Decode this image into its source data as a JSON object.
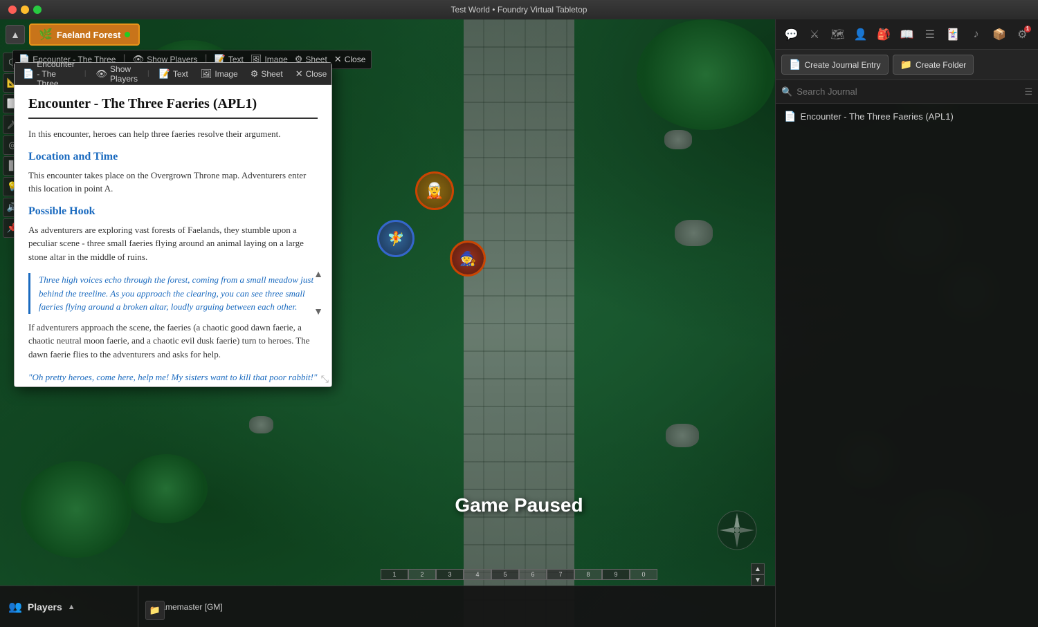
{
  "titlebar": {
    "title": "Test World • Foundry Virtual Tabletop"
  },
  "toolbar": {
    "scene_name": "Faeland Forest",
    "nav_up_icon": "▲"
  },
  "encounter_bar": {
    "encounter_name": "Encounter - The Three",
    "show_players": "Show Players",
    "text_label": "Text",
    "image_label": "Image",
    "sheet_label": "Sheet",
    "close_label": "Close"
  },
  "right_panel": {
    "icons": [
      {
        "name": "chat-icon",
        "symbol": "💬",
        "active": false
      },
      {
        "name": "combat-icon",
        "symbol": "⚔",
        "active": false
      },
      {
        "name": "scenes-icon",
        "symbol": "🗺",
        "active": false
      },
      {
        "name": "actors-icon",
        "symbol": "👤",
        "active": false
      },
      {
        "name": "items-icon",
        "symbol": "🎒",
        "active": false
      },
      {
        "name": "journal-icon",
        "symbol": "📖",
        "active": true
      },
      {
        "name": "tables-icon",
        "symbol": "☰",
        "active": false
      },
      {
        "name": "cards-icon",
        "symbol": "🃏",
        "active": false
      },
      {
        "name": "audio-icon",
        "symbol": "♪",
        "active": false
      },
      {
        "name": "compendium-icon",
        "symbol": "📦",
        "active": false
      },
      {
        "name": "settings-icon",
        "symbol": "⚙",
        "active": false,
        "badge": "1"
      }
    ],
    "create_journal_entry": "Create Journal Entry",
    "create_folder": "Create Folder",
    "search_placeholder": "Search Journal",
    "journal_items": [
      {
        "label": "Encounter - The Three Faeries (APL1)",
        "icon": "📄"
      }
    ]
  },
  "journal_popup": {
    "toolbar": [
      {
        "label": "Encounter Three",
        "icon": "📄"
      },
      {
        "label": "Show Players",
        "icon": "👁"
      },
      {
        "label": "Text",
        "icon": "📝"
      },
      {
        "label": "Image",
        "icon": "🖼"
      },
      {
        "label": "Sheet",
        "icon": "⚙"
      },
      {
        "label": "Close",
        "icon": "✕"
      }
    ],
    "title": "Encounter - The Three Faeries (APL1)",
    "intro": "In this encounter, heroes can help three faeries resolve their argument.",
    "section1_title": "Location and Time",
    "section1_body": "This encounter takes place on the Overgrown Throne map. Adventurers enter this location in point A.",
    "section2_title": "Possible Hook",
    "section2_body": "As adventurers are exploring vast forests of Faelands, they stumble upon a peculiar scene - three small faeries flying around an animal laying on a large stone altar in the middle of ruins.",
    "blockquote": "Three high voices echo through the forest, coming from a small meadow just behind the treeline. As you approach the clearing, you can see three small faeries flying around a broken altar, loudly arguing between each other.",
    "section3_body": "If adventurers approach the scene, the faeries (a chaotic good dawn faerie, a chaotic neutral moon faerie, and a chaotic evil dusk faerie) turn to heroes. The dawn faerie flies to the adventurers and asks for help.",
    "quote2": "\"Oh pretty heroes, come here, help me! My sisters want to kill that poor rabbit!\" cries one faerie, flying to you, but not letting..."
  },
  "bottom_bar": {
    "players_label": "Players",
    "players_icon": "👥",
    "players": [
      {
        "name": "Gamemaster [GM]",
        "online": true,
        "color": "#22cc22"
      }
    ]
  },
  "game_paused": "Game Paused",
  "scale_cells": [
    "1",
    "2",
    "3",
    "4",
    "5",
    "6",
    "7",
    "8",
    "9",
    "0"
  ]
}
